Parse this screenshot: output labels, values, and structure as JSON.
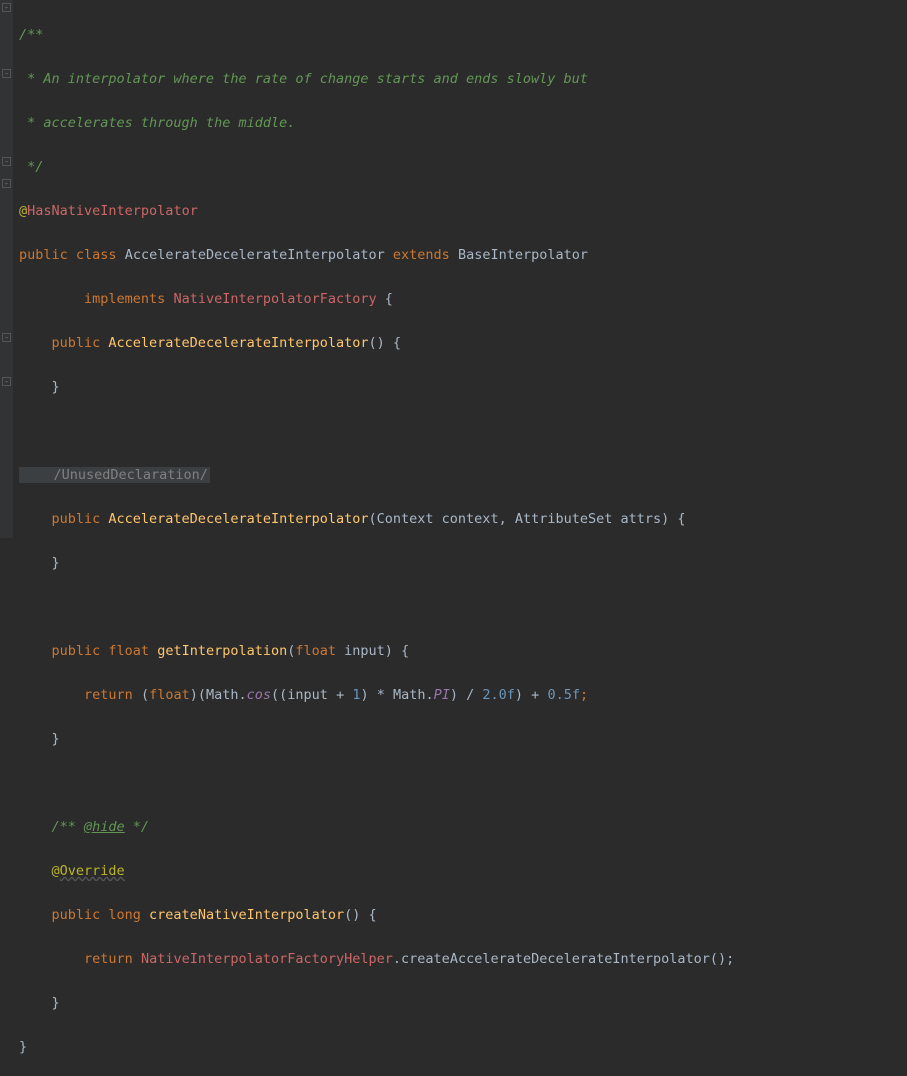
{
  "doc": {
    "open": "/**",
    "l1": " * An interpolator where the rate of change starts and ends slowly but",
    "l2": " * accelerates through the middle.",
    "close": " */"
  },
  "anno_hasnative_at": "@",
  "anno_hasnative": "HasNativeInterpolator",
  "decl": {
    "kw_public": "public ",
    "kw_class": "class ",
    "name": "AccelerateDecelerateInterpolator ",
    "kw_extends": "extends ",
    "super": "BaseInterpolator",
    "indent": "        ",
    "kw_implements": "implements ",
    "iface": "NativeInterpolatorFactory ",
    "brace": "{"
  },
  "ctor1": {
    "kw_public": "    public ",
    "name": "AccelerateDecelerateInterpolator",
    "parens": "() {",
    "close": "    }"
  },
  "folded_unused": "    /UnusedDeclaration/",
  "ctor2": {
    "kw_public": "    public ",
    "name": "AccelerateDecelerateInterpolator",
    "open": "(",
    "ptype1": "Context ",
    "pname1": "context",
    "sep": ", ",
    "ptype2": "AttributeSet ",
    "pname2": "attrs",
    "close_par": ") {",
    "close": "    }"
  },
  "getinterp": {
    "kw_public": "    public ",
    "kw_float": "float ",
    "name": "getInterpolation",
    "open": "(",
    "ptype": "float ",
    "pname": "input",
    "close_par": ") {",
    "ret_indent": "        ",
    "kw_return": "return ",
    "cast_open": "(",
    "kw_float2": "float",
    "cast_close": ")(",
    "math1": "Math.",
    "cos": "cos",
    "expr_open": "((",
    "input": "input ",
    "plus": "+ ",
    "one": "1",
    "times": ") * ",
    "math2": "Math.",
    "pi": "PI",
    "div": ") / ",
    "two": "2.0f",
    "plus2": ") + ",
    "half": "0.5f",
    "semi": ";",
    "close": "    }"
  },
  "hidecomment": {
    "open": "    /** ",
    "hide": "@hide",
    "close": " */"
  },
  "override": {
    "indent": "    ",
    "at": "@",
    "name": "Override"
  },
  "createnative": {
    "kw_public": "    public ",
    "kw_long": "long ",
    "name": "createNativeInterpolator",
    "parens": "() {",
    "ret_indent": "        ",
    "kw_return": "return ",
    "helper": "NativeInterpolatorFactoryHelper",
    "dot": ".",
    "method": "createAccelerateDecelerateInterpolator",
    "call": "();",
    "close": "    }"
  },
  "classclose": "}"
}
